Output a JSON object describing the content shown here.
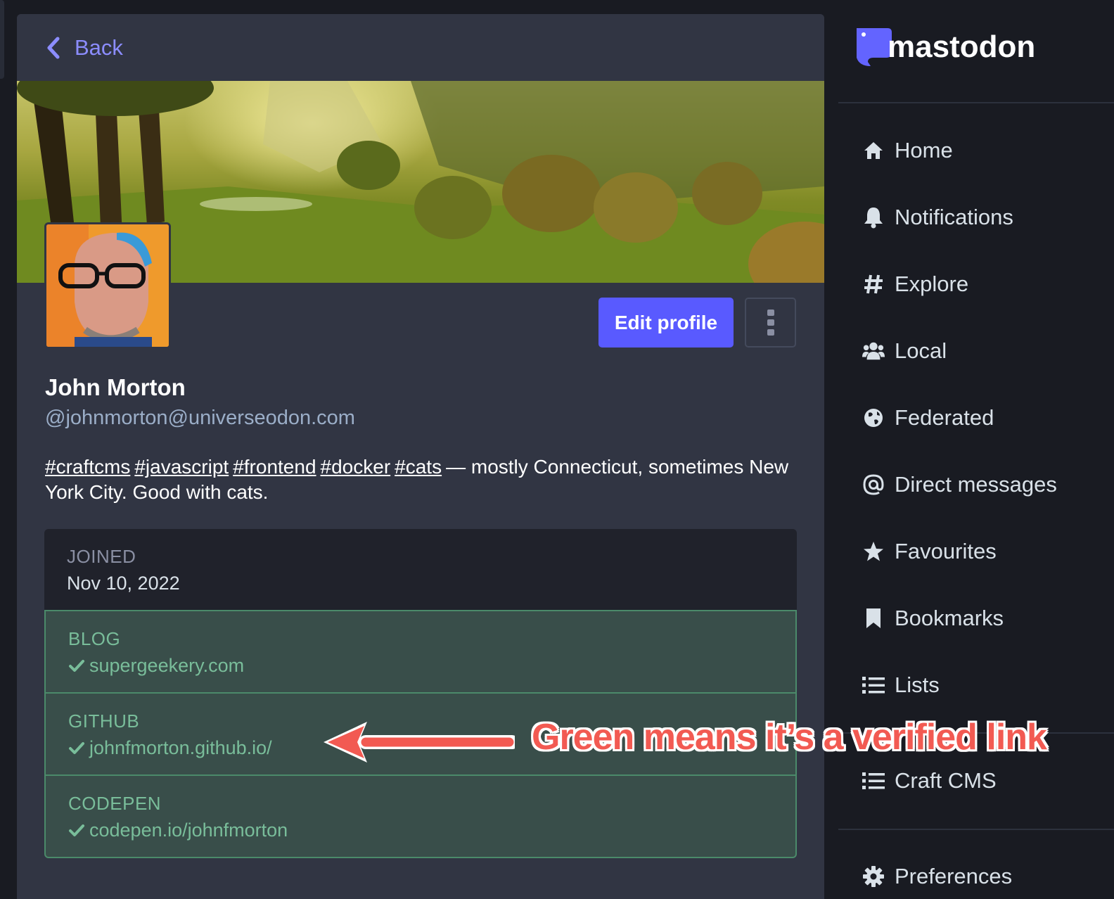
{
  "back": {
    "label": "Back"
  },
  "profile": {
    "display_name": "John Morton",
    "handle": "@johnmorton@universeodon.com",
    "hashtags": [
      "#craftcms",
      "#javascript",
      "#frontend",
      "#docker",
      "#cats"
    ],
    "bio_text": "— mostly Connecticut, sometimes New York City. Good with cats.",
    "edit_button": "Edit profile"
  },
  "fields": {
    "joined": {
      "label": "JOINED",
      "value": "Nov 10, 2022"
    },
    "verified": [
      {
        "label": "BLOG",
        "value": "supergeekery.com"
      },
      {
        "label": "GITHUB",
        "value": "johnfmorton.github.io/"
      },
      {
        "label": "CODEPEN",
        "value": "codepen.io/johnfmorton"
      }
    ]
  },
  "sidebar": {
    "logo": "mastodon",
    "items": [
      {
        "label": "Home",
        "icon": "home-icon"
      },
      {
        "label": "Notifications",
        "icon": "bell-icon"
      },
      {
        "label": "Explore",
        "icon": "hashtag-icon"
      },
      {
        "label": "Local",
        "icon": "users-icon"
      },
      {
        "label": "Federated",
        "icon": "globe-icon"
      },
      {
        "label": "Direct messages",
        "icon": "at-icon"
      },
      {
        "label": "Favourites",
        "icon": "star-icon"
      },
      {
        "label": "Bookmarks",
        "icon": "bookmark-icon"
      },
      {
        "label": "Lists",
        "icon": "list-icon"
      }
    ],
    "list_item": {
      "label": "Craft CMS",
      "icon": "list-icon"
    },
    "preferences": {
      "label": "Preferences",
      "icon": "gear-icon"
    }
  },
  "annotation": {
    "text": "Green means it’s a verified link"
  },
  "colors": {
    "accent": "#595aff",
    "link": "#8c8dff",
    "verified": "#79bd9a",
    "annotation": "#f25a52"
  }
}
